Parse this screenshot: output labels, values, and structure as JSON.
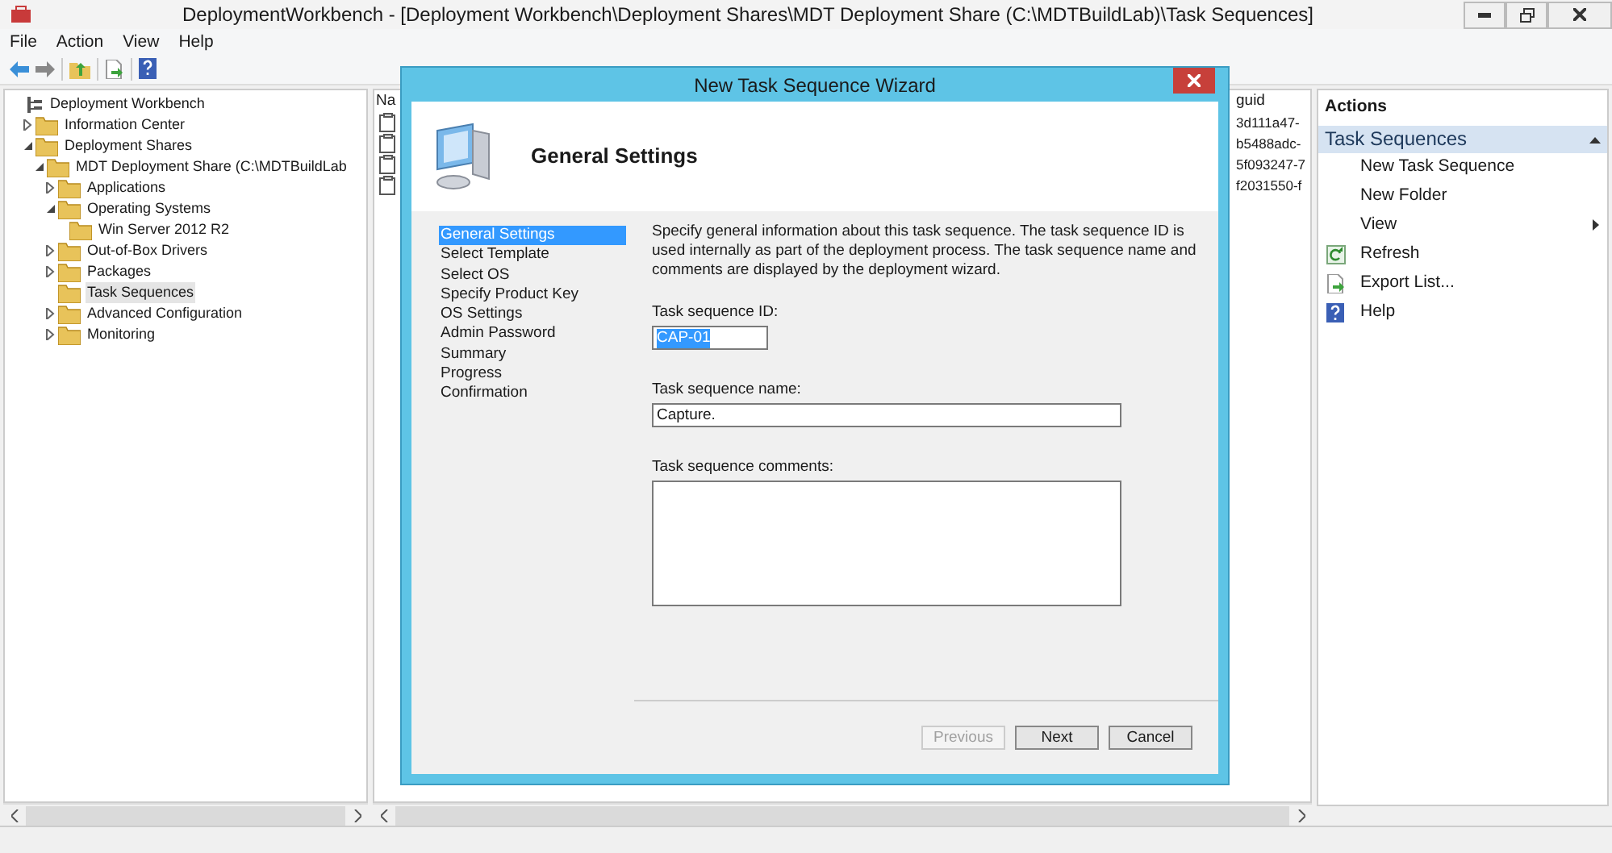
{
  "window": {
    "title": "DeploymentWorkbench - [Deployment Workbench\\Deployment Shares\\MDT Deployment Share (C:\\MDTBuildLab)\\Task Sequences]"
  },
  "menu": [
    "File",
    "Action",
    "View",
    "Help"
  ],
  "tree": [
    {
      "label": "Deployment Workbench",
      "kind": "root",
      "selected": false,
      "children": [
        {
          "label": "Information Center",
          "expanded": false,
          "selected": false
        },
        {
          "label": "Deployment Shares",
          "expanded": true,
          "selected": false,
          "children": [
            {
              "label": "MDT Deployment Share (C:\\MDTBuildLab",
              "expanded": true,
              "selected": false,
              "children": [
                {
                  "label": "Applications",
                  "expanded": false,
                  "selected": false
                },
                {
                  "label": "Operating Systems",
                  "expanded": true,
                  "selected": false,
                  "children": [
                    {
                      "label": "Win Server 2012 R2",
                      "selected": false
                    }
                  ]
                },
                {
                  "label": "Out-of-Box Drivers",
                  "expanded": false,
                  "selected": false
                },
                {
                  "label": "Packages",
                  "expanded": false,
                  "selected": false
                },
                {
                  "label": "Task Sequences",
                  "selected": true
                },
                {
                  "label": "Advanced Configuration",
                  "expanded": false,
                  "selected": false
                },
                {
                  "label": "Monitoring",
                  "expanded": false,
                  "selected": false
                }
              ]
            }
          ]
        }
      ]
    }
  ],
  "list": {
    "columns": [
      "Na",
      "guid"
    ],
    "rows": [
      {
        "column_2": "3d111a47-"
      },
      {
        "column_2": "b5488adc-"
      },
      {
        "column_2": "5f093247-7"
      },
      {
        "column_2": "f2031550-f"
      }
    ]
  },
  "actions": {
    "title": "Actions",
    "section": {
      "title": "Task Sequences",
      "expanded": true
    },
    "items": [
      {
        "label": "New Task Sequence",
        "kind": "text"
      },
      {
        "label": "New Folder",
        "kind": "text"
      },
      {
        "label": "View",
        "kind": "submenu"
      },
      {
        "label": "Refresh",
        "kind": "refresh"
      },
      {
        "label": "Export List...",
        "kind": "export"
      },
      {
        "label": "Help",
        "kind": "help"
      }
    ]
  },
  "wizard": {
    "title": "New Task Sequence Wizard",
    "heading": "General Settings",
    "steps": [
      {
        "label": "General Settings",
        "selected": true
      },
      {
        "label": "Select Template",
        "selected": false
      },
      {
        "label": "Select OS",
        "selected": false
      },
      {
        "label": "Specify Product Key",
        "selected": false
      },
      {
        "label": "OS Settings",
        "selected": false
      },
      {
        "label": "Admin Password",
        "selected": false
      },
      {
        "label": "Summary",
        "selected": false
      },
      {
        "label": "Progress",
        "selected": false
      },
      {
        "label": "Confirmation",
        "selected": false
      }
    ],
    "description": "Specify general information about this task sequence.  The task sequence ID is used internally as part of the deployment process.  The task sequence name and comments are displayed by the deployment wizard.",
    "fields": [
      {
        "label": "Task sequence ID:",
        "value": "CAP-01",
        "kind": "short",
        "highlighted": true
      },
      {
        "label": "Task sequence name:",
        "value": "Capture.",
        "kind": "wide"
      },
      {
        "label": "Task sequence comments:",
        "kind": "multiline"
      }
    ],
    "buttons": [
      {
        "label": "Previous",
        "disabled": true
      },
      {
        "label": "Next",
        "disabled": false
      },
      {
        "label": "Cancel",
        "disabled": false
      }
    ]
  }
}
